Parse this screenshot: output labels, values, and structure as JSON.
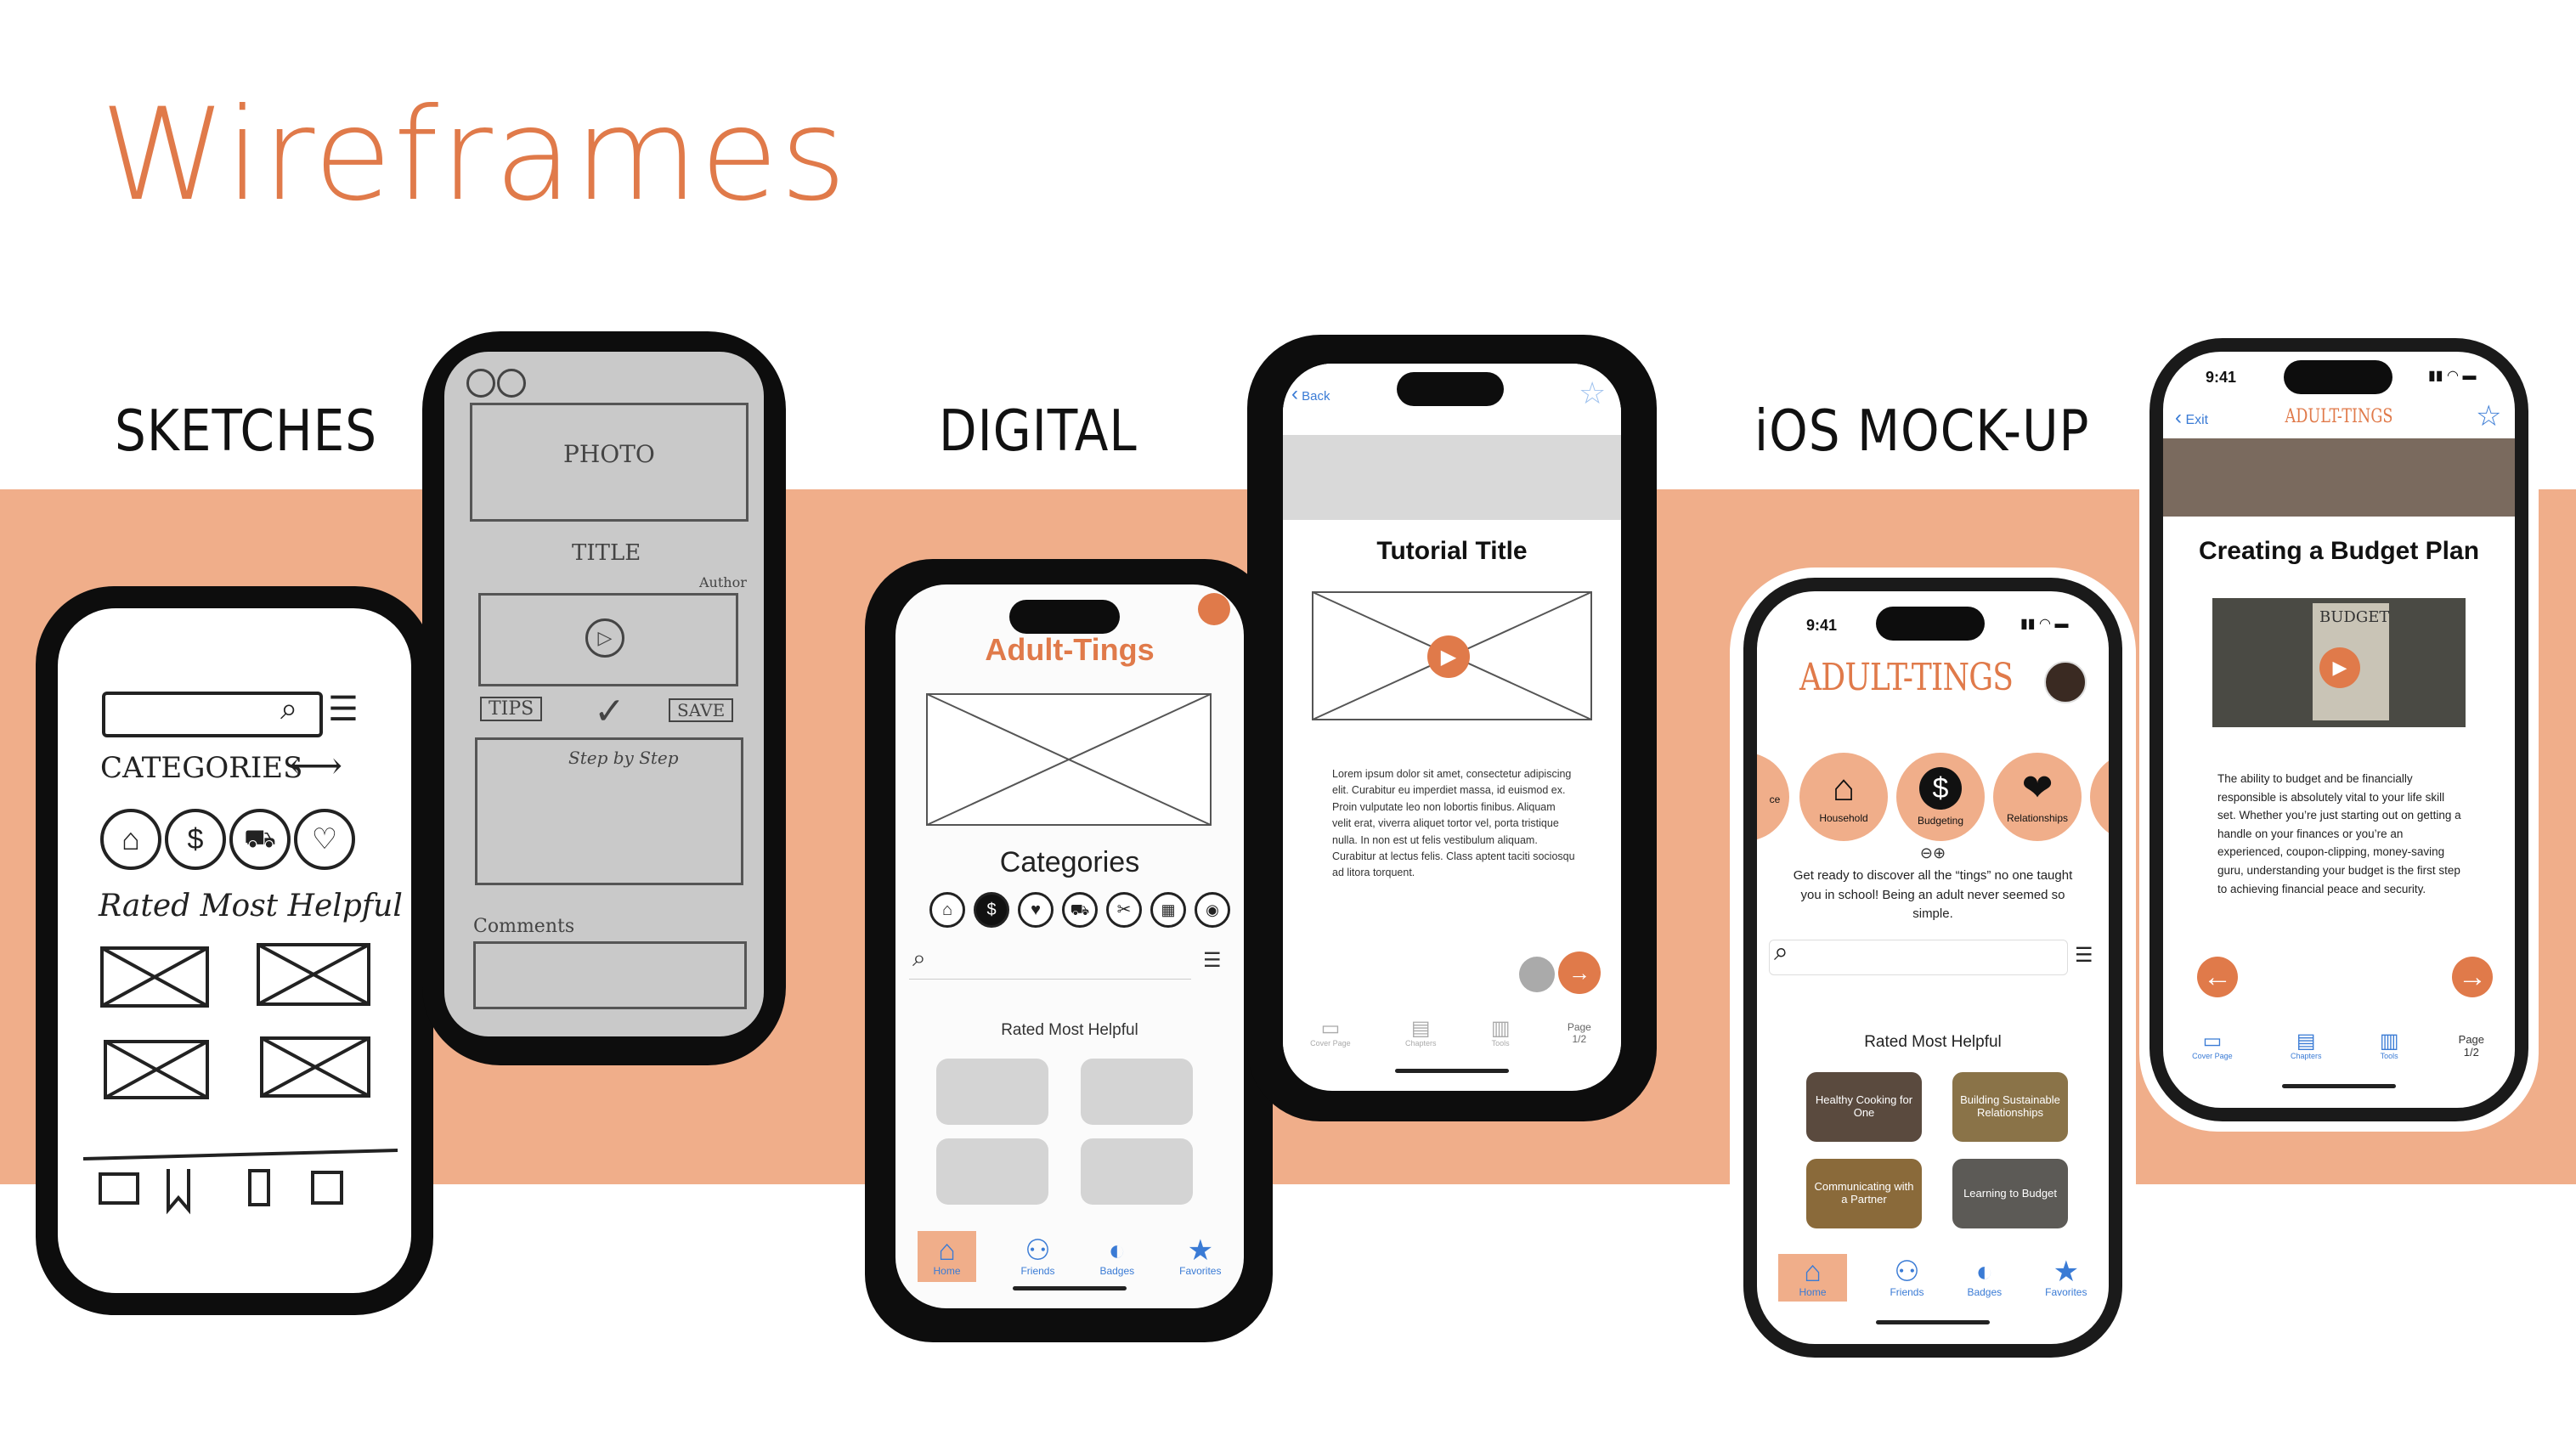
{
  "page": {
    "title": "Wireframes",
    "sections": {
      "sketches": "SKETCHES",
      "digital": "DIGITAL",
      "ios": "iOS MOCK-UP"
    }
  },
  "colors": {
    "accent": "#e07a4a",
    "band": "#f0ae8a",
    "link": "#3a7bd5"
  },
  "sketch_home": {
    "categories_label": "CATEGORIES",
    "rated_label": "Rated Most Helpful"
  },
  "sketch_tutorial": {
    "photo": "PHOTO",
    "title": "TITLE",
    "author": "Author",
    "tips": "TIPS",
    "save": "SAVE",
    "step": "Step by Step",
    "comments": "Comments"
  },
  "digital_home": {
    "app_name": "Adult-Tings",
    "categories": "Categories",
    "rated": "Rated Most Helpful",
    "tabs": [
      "Home",
      "Friends",
      "Badges",
      "Favorites"
    ]
  },
  "digital_tutorial": {
    "back": "Back",
    "title": "Tutorial Title",
    "body": "Lorem ipsum dolor sit amet, consectetur adipiscing elit. Curabitur eu imperdiet massa, id euismod ex. Proin vulputate leo non lobortis finibus. Aliquam velit erat, viverra aliquet tortor vel, porta tristique nulla. In non est ut felis vestibulum aliquam. Curabitur at lectus felis. Class aptent taciti sociosqu ad litora torquent.",
    "tabs": [
      "Cover Page",
      "Chapters",
      "Tools",
      "Page 1/2"
    ]
  },
  "ios_home": {
    "time": "9:41",
    "app_name": "ADULT-TINGS",
    "categories": [
      "Household",
      "Budgeting",
      "Relationships"
    ],
    "partial_left": "ce",
    "intro": "Get ready to discover all the “tings” no one taught you in school! Being an adult never seemed so simple.",
    "rated": "Rated Most Helpful",
    "cards": [
      "Healthy Cooking for One",
      "Building Sustainable Relationships",
      "Communicating with a Partner",
      "Learning to Budget"
    ],
    "tabs": [
      "Home",
      "Friends",
      "Badges",
      "Favorites"
    ]
  },
  "ios_tutorial": {
    "time": "9:41",
    "exit": "Exit",
    "app_name": "ADULT-TINGS",
    "title": "Creating a Budget Plan",
    "image_text": "BUDGET",
    "body": "The ability to budget and be financially responsible is absolutely vital to your life skill set. Whether you’re just starting out on getting a handle on your finances or you’re an experienced, coupon-clipping, money-saving guru, understanding your budget is the first step to achieving financial peace and security.",
    "tabs": [
      "Cover Page",
      "Chapters",
      "Tools",
      "Page 1/2"
    ]
  }
}
